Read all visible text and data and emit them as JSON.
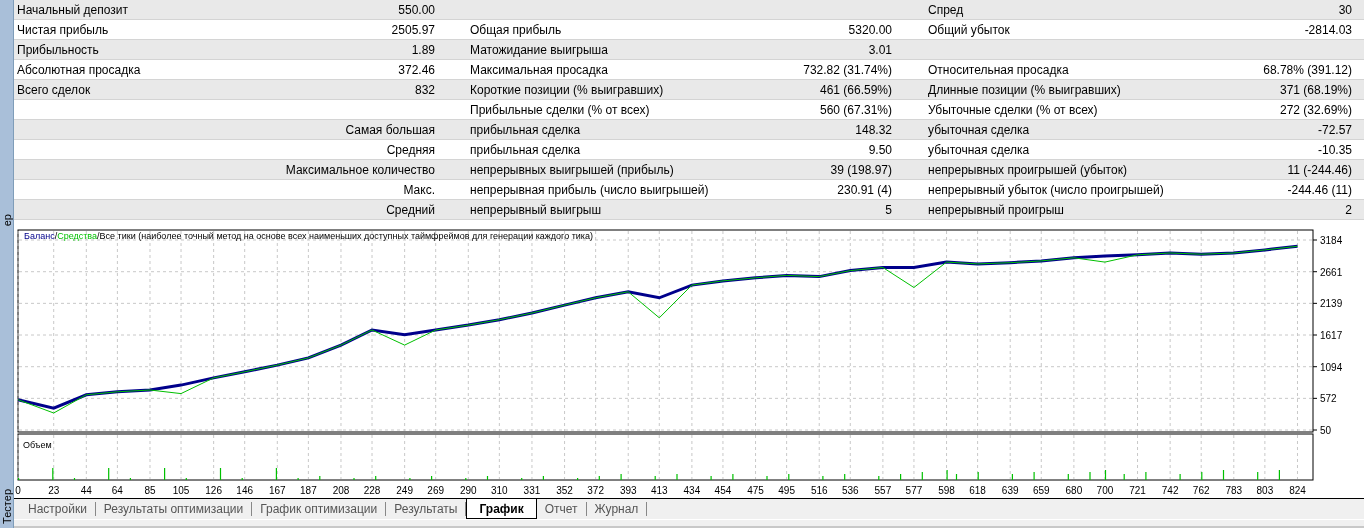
{
  "side_strip": {
    "top_label": "ер",
    "bottom_label": "Тестер"
  },
  "stats": {
    "rows": [
      {
        "kind": "summary",
        "label_1": "Начальный депозит",
        "value_1": "550.00",
        "label_3": "Спред",
        "value_3": "30"
      },
      {
        "kind": "summary",
        "label_1": "Чистая прибыль",
        "value_1": "2505.97",
        "label_2": "Общая прибыль",
        "value_2": "5320.00",
        "label_3": "Общий убыток",
        "value_3": "-2814.03"
      },
      {
        "kind": "summary",
        "label_1": "Прибыльность",
        "value_1": "1.89",
        "label_2": "Матожидание выигрыша",
        "value_2": "3.01"
      },
      {
        "kind": "summary",
        "label_1": "Абсолютная просадка",
        "value_1": "372.46",
        "label_2": "Максимальная просадка",
        "value_2": "732.82 (31.74%)",
        "label_3": "Относительная просадка",
        "value_3": "68.78% (391.12)"
      },
      {
        "kind": "summary",
        "label_1": "Всего сделок",
        "value_1": "832",
        "label_2": "Короткие позиции (% выигравших)",
        "value_2": "461 (66.59%)",
        "label_3": "Длинные позиции (% выигравших)",
        "value_3": "371 (68.19%)"
      },
      {
        "kind": "summary",
        "label_2": "Прибыльные сделки (% от всех)",
        "value_2": "560 (67.31%)",
        "label_3": "Убыточные сделки (% от всех)",
        "value_3": "272 (32.69%)"
      },
      {
        "kind": "detail",
        "label_1": "Самая большая",
        "label_2": "прибыльная сделка",
        "value_2": "148.32",
        "label_3": "убыточная сделка",
        "value_3": "-72.57"
      },
      {
        "kind": "detail",
        "label_1": "Средняя",
        "label_2": "прибыльная сделка",
        "value_2": "9.50",
        "label_3": "убыточная сделка",
        "value_3": "-10.35"
      },
      {
        "kind": "detail",
        "label_1": "Максимальное количество",
        "label_2": "непрерывных выигрышей (прибыль)",
        "value_2": "39 (198.97)",
        "label_3": "непрерывных проигрышей (убыток)",
        "value_3": "11 (-244.46)"
      },
      {
        "kind": "detail",
        "label_1": "Макс.",
        "label_2": "непрерывная прибыль (число выигрышей)",
        "value_2": "230.91 (4)",
        "label_3": "непрерывный убыток (число проигрышей)",
        "value_3": "-244.46 (11)"
      },
      {
        "kind": "detail",
        "label_1": "Средний",
        "label_2": "непрерывный выигрыш",
        "value_2": "5",
        "label_3": "непрерывный проигрыш",
        "value_3": "2"
      }
    ]
  },
  "chart": {
    "legend_separator": "/",
    "mode_label": "Все тики (наиболее точный метод на основе всех наименьших доступных таймфреймов для генерации каждого тика)",
    "volume_label": "Объем",
    "chart_data": {
      "type": "line",
      "grid": true,
      "x": [
        0,
        23,
        44,
        64,
        85,
        105,
        126,
        146,
        167,
        187,
        208,
        228,
        249,
        269,
        290,
        310,
        331,
        352,
        372,
        393,
        413,
        434,
        454,
        475,
        495,
        516,
        536,
        557,
        577,
        598,
        618,
        639,
        659,
        680,
        700,
        721,
        742,
        762,
        783,
        803,
        824
      ],
      "series": [
        {
          "name": "Баланс",
          "color": "#00008b",
          "values": [
            550,
            410,
            630,
            680,
            710,
            790,
            910,
            1010,
            1120,
            1240,
            1450,
            1700,
            1620,
            1700,
            1780,
            1870,
            1980,
            2110,
            2230,
            2330,
            2230,
            2440,
            2510,
            2560,
            2600,
            2580,
            2680,
            2730,
            2730,
            2820,
            2790,
            2810,
            2840,
            2890,
            2920,
            2940,
            2970,
            2950,
            2970,
            3020,
            3080
          ]
        },
        {
          "name": "Средства",
          "color": "#00c000",
          "values": [
            550,
            330,
            630,
            680,
            710,
            650,
            910,
            1010,
            1120,
            1240,
            1450,
            1700,
            1450,
            1700,
            1780,
            1870,
            1980,
            2110,
            2230,
            2330,
            1900,
            2440,
            2510,
            2560,
            2600,
            2580,
            2680,
            2730,
            2400,
            2820,
            2790,
            2810,
            2840,
            2890,
            2820,
            2940,
            2970,
            2950,
            2970,
            3020,
            3080
          ]
        }
      ],
      "xlim": [
        0,
        834
      ],
      "ylim": [
        50,
        3184
      ],
      "xticks": [
        0,
        23,
        44,
        64,
        85,
        105,
        126,
        146,
        167,
        187,
        208,
        228,
        249,
        269,
        290,
        310,
        331,
        352,
        372,
        393,
        413,
        434,
        454,
        475,
        495,
        516,
        536,
        557,
        577,
        598,
        618,
        639,
        659,
        680,
        700,
        721,
        742,
        762,
        783,
        803,
        824
      ],
      "yticks": [
        50,
        572,
        1094,
        1617,
        2139,
        2661,
        3184
      ]
    }
  },
  "tabs": [
    {
      "label": "Настройки",
      "selected": false
    },
    {
      "label": "Результаты оптимизации",
      "selected": false
    },
    {
      "label": "График оптимизации",
      "selected": false
    },
    {
      "label": "Результаты",
      "selected": false
    },
    {
      "label": "График",
      "selected": true
    },
    {
      "label": "Отчет",
      "selected": false
    },
    {
      "label": "Журнал",
      "selected": false
    }
  ]
}
